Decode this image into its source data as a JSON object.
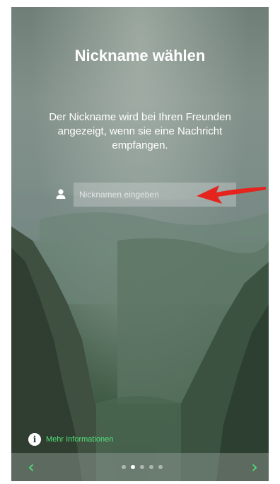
{
  "onboarding": {
    "title": "Nickname wählen",
    "description": "Der Nickname wird bei Ihren Freunden angezeigt, wenn sie eine Nachricht empfangen.",
    "nickname_placeholder": "Nicknamen eingeben",
    "nickname_value": "",
    "more_info_label": "Mehr Informationen"
  },
  "pager": {
    "page_count": 5,
    "active_page": 2,
    "prev_icon": "chevron-left-icon",
    "next_icon": "chevron-right-icon"
  },
  "colors": {
    "accent_green": "#52e27a",
    "annotation_arrow": "#e5241e"
  },
  "icons": {
    "user": "user-icon",
    "info": "info-icon",
    "annotation": "red-arrow-icon"
  }
}
